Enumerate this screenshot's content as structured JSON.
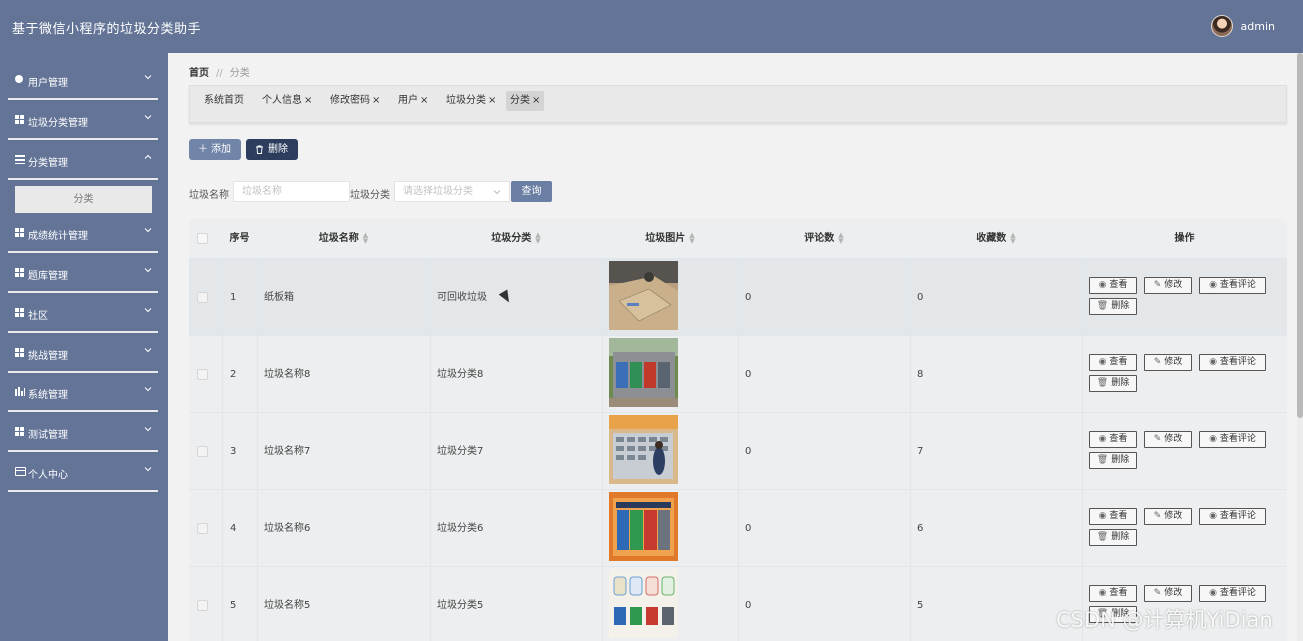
{
  "header": {
    "title": "基于微信小程序的垃圾分类助手",
    "username": "admin"
  },
  "sidebar": {
    "items": [
      {
        "label": "用户管理",
        "icon": "pin-icon"
      },
      {
        "label": "垃圾分类管理",
        "icon": "grid-icon"
      },
      {
        "label": "分类管理",
        "icon": "list-icon",
        "expanded": true
      },
      {
        "label": "成绩统计管理",
        "icon": "grid-icon"
      },
      {
        "label": "题库管理",
        "icon": "grid-icon"
      },
      {
        "label": "社区",
        "icon": "grid-icon"
      },
      {
        "label": "挑战管理",
        "icon": "grid-icon"
      },
      {
        "label": "系统管理",
        "icon": "bar-chart-icon"
      },
      {
        "label": "测试管理",
        "icon": "grid-icon"
      },
      {
        "label": "个人中心",
        "icon": "card-icon"
      }
    ],
    "subitem": "分类"
  },
  "breadcrumb": {
    "home": "首页",
    "separator": "//",
    "current": "分类"
  },
  "tabs": [
    {
      "label": "系统首页",
      "closable": false
    },
    {
      "label": "个人信息",
      "closable": true
    },
    {
      "label": "修改密码",
      "closable": true
    },
    {
      "label": "用户",
      "closable": true
    },
    {
      "label": "垃圾分类",
      "closable": true
    },
    {
      "label": "分类",
      "closable": true,
      "active": true
    }
  ],
  "tab_close": "×",
  "toolbar": {
    "add_label": "添加",
    "delete_label": "删除"
  },
  "search": {
    "name_label": "垃圾名称",
    "name_placeholder": "垃圾名称",
    "category_label": "垃圾分类",
    "category_placeholder": "请选择垃圾分类",
    "query_label": "查询"
  },
  "table": {
    "columns": [
      "序号",
      "垃圾名称",
      "垃圾分类",
      "垃圾图片",
      "评论数",
      "收藏数",
      "操作"
    ],
    "rows": [
      {
        "index": "1",
        "name": "纸板箱",
        "category": "可回收垃圾",
        "comments": "0",
        "favorites": "0"
      },
      {
        "index": "2",
        "name": "垃圾名称8",
        "category": "垃圾分类8",
        "comments": "0",
        "favorites": "8"
      },
      {
        "index": "3",
        "name": "垃圾名称7",
        "category": "垃圾分类7",
        "comments": "0",
        "favorites": "7"
      },
      {
        "index": "4",
        "name": "垃圾名称6",
        "category": "垃圾分类6",
        "comments": "0",
        "favorites": "6"
      },
      {
        "index": "5",
        "name": "垃圾名称5",
        "category": "垃圾分类5",
        "comments": "0",
        "favorites": "5"
      }
    ],
    "actions": {
      "view": "查看",
      "edit": "修改",
      "view_comments": "查看评论",
      "delete": "删除"
    }
  },
  "watermark": "CSDN @计算机YiDian",
  "colors": {
    "header": "#637497",
    "sidebar": "#637497",
    "add_button": "#7085a8",
    "delete_button": "#2d3d5e"
  }
}
